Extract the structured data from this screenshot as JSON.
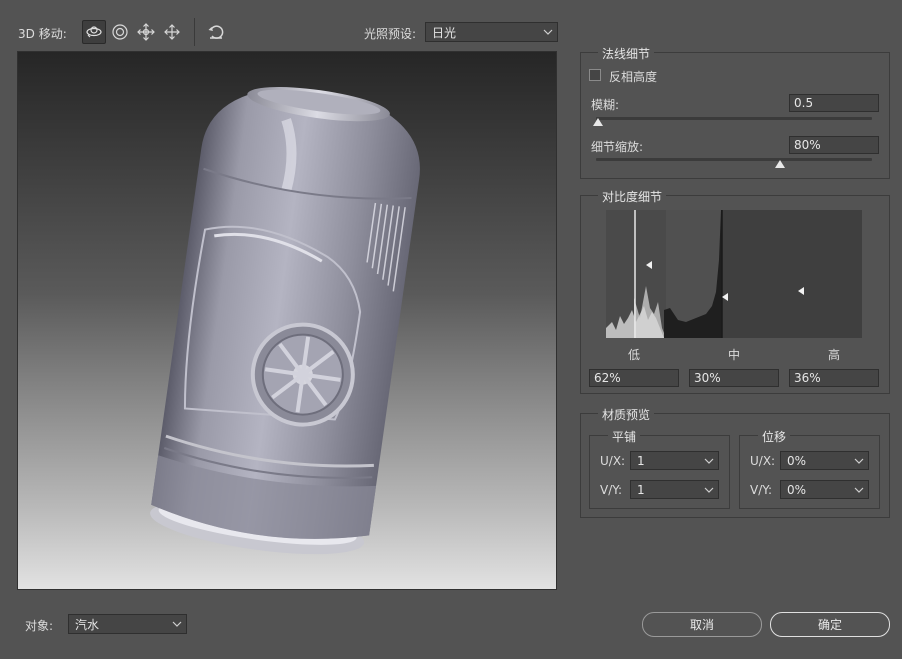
{
  "toolbar": {
    "move_label": "3D 移动:",
    "lighting_label": "光照预设:",
    "lighting_value": "日光",
    "tools": [
      "orbit-icon",
      "rotate-icon",
      "pan-icon",
      "slide-icon",
      "reset-icon"
    ]
  },
  "normal_detail": {
    "title": "法线细节",
    "invert_height_label": "反相高度",
    "invert_height_checked": false,
    "blur_label": "模糊:",
    "blur_value": "0.5",
    "blur_position": 0.0,
    "detail_scale_label": "细节缩放:",
    "detail_scale_value": "80%",
    "detail_scale_position": 0.8
  },
  "contrast_detail": {
    "title": "对比度细节",
    "low_label": "低",
    "mid_label": "中",
    "high_label": "高",
    "low_value": "62%",
    "mid_value": "30%",
    "high_value": "36%"
  },
  "material_preview": {
    "title": "材质预览",
    "tiling": {
      "title": "平铺",
      "ux_label": "U/X:",
      "ux_value": "1",
      "vy_label": "V/Y:",
      "vy_value": "1"
    },
    "offset": {
      "title": "位移",
      "ux_label": "U/X:",
      "ux_value": "0%",
      "vy_label": "V/Y:",
      "vy_value": "0%"
    }
  },
  "footer": {
    "object_label": "对象:",
    "object_value": "汽水",
    "cancel_label": "取消",
    "ok_label": "确定"
  },
  "colors": {
    "background": "#535353",
    "field": "#454545",
    "can_body": "#9a9aa8"
  }
}
